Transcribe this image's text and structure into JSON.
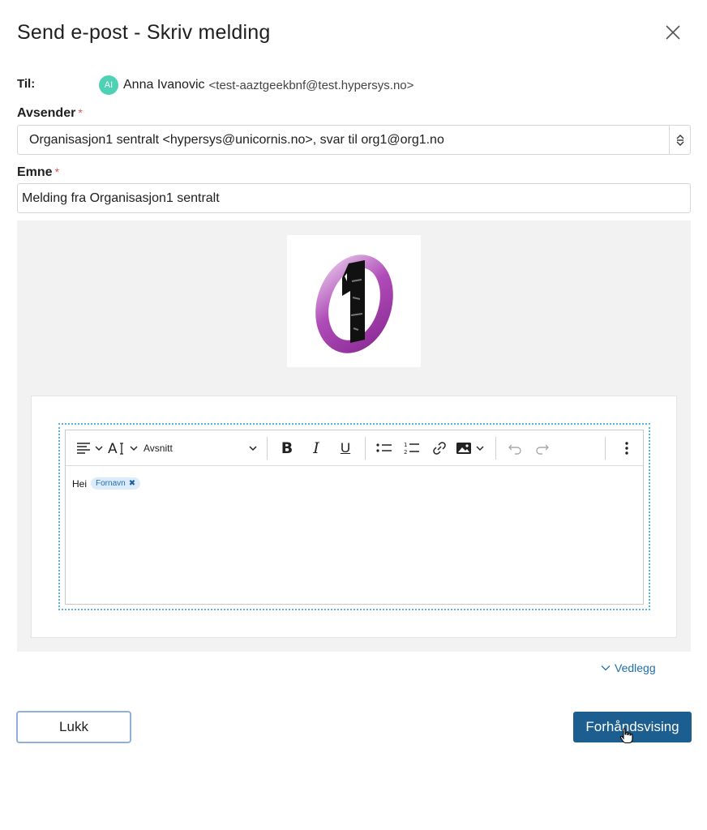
{
  "dialog": {
    "title": "Send e-post - Skriv melding"
  },
  "recipient": {
    "label": "Til:",
    "initials": "AI",
    "name": "Anna Ivanovic",
    "email": "<test-aaztgeekbnf@test.hypersys.no>",
    "avatar_color": "#4fd1b5"
  },
  "sender": {
    "label": "Avsender",
    "required_mark": "*",
    "value": "Organisasjon1 sentralt <hypersys@unicornis.no>, svar til org1@org1.no"
  },
  "subject": {
    "label": "Emne",
    "required_mark": "*",
    "value": "Melding fra Organisasjon1 sentralt"
  },
  "editor": {
    "toolbar": {
      "block_format": "Avsnitt",
      "bold": "B",
      "italic": "I",
      "underline": "U"
    },
    "body_text": "Hei",
    "merge_tag": "Fornavn"
  },
  "attachments": {
    "label": "Vedlegg"
  },
  "actions": {
    "close_label": "Lukk",
    "preview_label": "Forhåndsvising"
  },
  "colors": {
    "primary": "#1b5e8f",
    "link": "#1f6fb2",
    "required": "#e05555",
    "logo_purple": "#a43da8"
  }
}
